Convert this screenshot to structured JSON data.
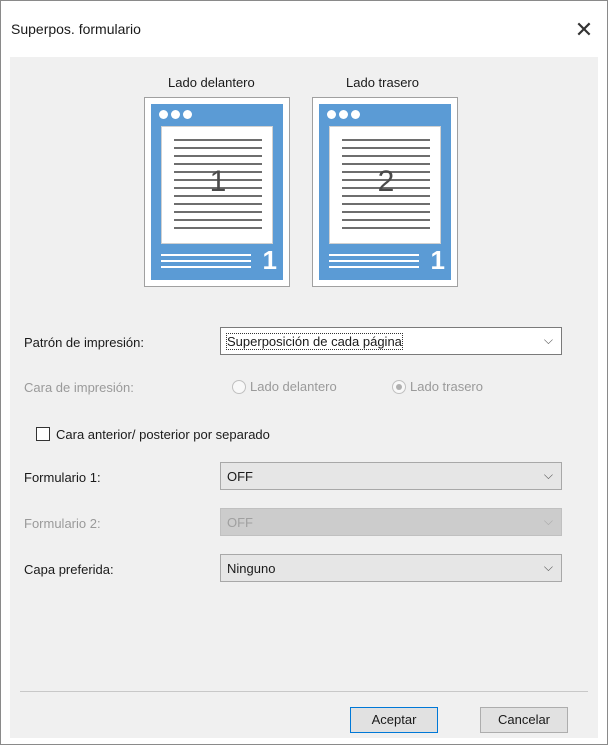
{
  "window": {
    "title": "Superpos. formulario",
    "close_icon": "close-icon"
  },
  "preview": {
    "front": {
      "caption": "Lado delantero",
      "page_number": "1",
      "corner_number": "1"
    },
    "back": {
      "caption": "Lado trasero",
      "page_number": "2",
      "corner_number": "1"
    }
  },
  "form": {
    "print_pattern": {
      "label": "Patrón de impresión:",
      "value": "Superposición de cada página"
    },
    "print_side": {
      "label": "Cara de impresión:",
      "options": [
        {
          "label": "Lado delantero",
          "checked": false
        },
        {
          "label": "Lado trasero",
          "checked": true
        }
      ]
    },
    "separate_checkbox": {
      "label": "Cara anterior/ posterior por separado",
      "checked": false
    },
    "form1": {
      "label": "Formulario 1:",
      "value": "OFF"
    },
    "form2": {
      "label": "Formulario 2:",
      "value": "OFF"
    },
    "preferred_layer": {
      "label": "Capa preferida:",
      "value": "Ninguno"
    }
  },
  "buttons": {
    "ok": "Aceptar",
    "cancel": "Cancelar"
  },
  "colors": {
    "accent_blue": "#5b9bd5",
    "focus_border": "#0078d7"
  }
}
